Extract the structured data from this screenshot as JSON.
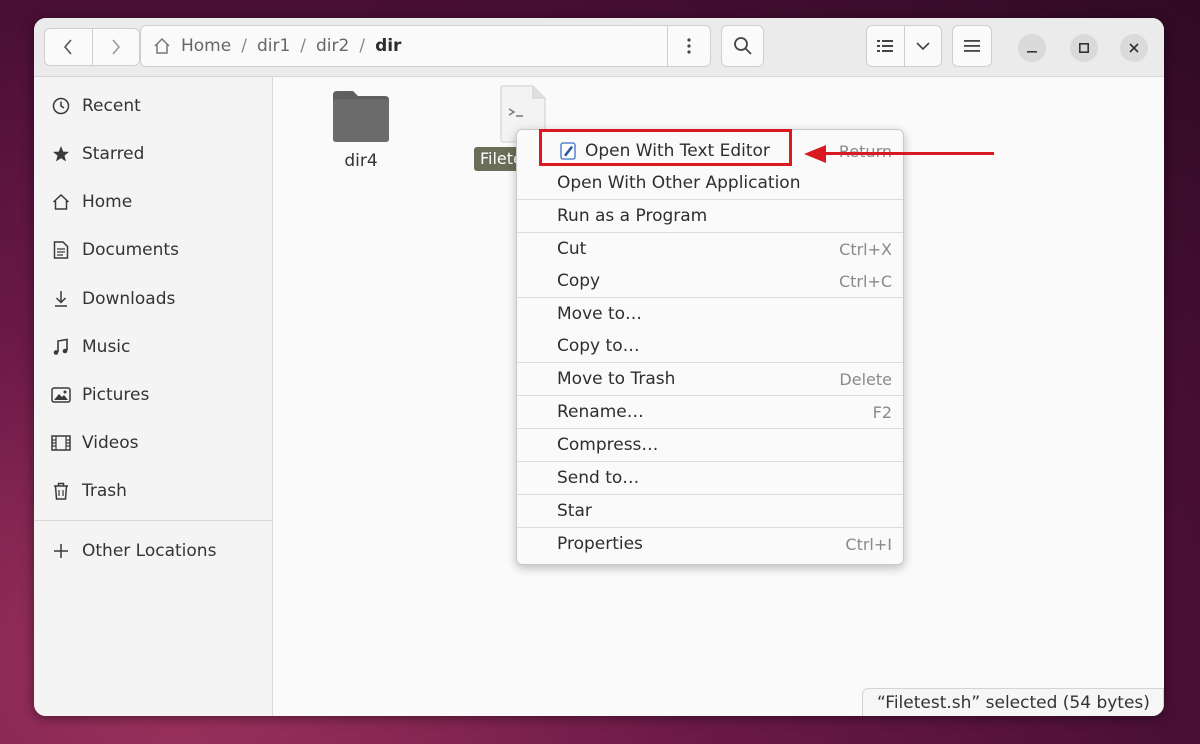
{
  "headerbar": {
    "path": [
      "Home",
      "dir1",
      "dir2",
      "dir"
    ],
    "path_separator": "/"
  },
  "sidebar": {
    "items": [
      {
        "label": "Recent",
        "icon": "clock-icon"
      },
      {
        "label": "Starred",
        "icon": "star-icon"
      },
      {
        "label": "Home",
        "icon": "home-icon"
      },
      {
        "label": "Documents",
        "icon": "document-icon"
      },
      {
        "label": "Downloads",
        "icon": "download-icon"
      },
      {
        "label": "Music",
        "icon": "music-icon"
      },
      {
        "label": "Pictures",
        "icon": "picture-icon"
      },
      {
        "label": "Videos",
        "icon": "video-icon"
      },
      {
        "label": "Trash",
        "icon": "trash-icon"
      }
    ],
    "other_locations": "Other Locations"
  },
  "files": [
    {
      "name": "dir4",
      "type": "folder"
    },
    {
      "name": "Filetest.sh",
      "type": "script",
      "selected": true
    }
  ],
  "context_menu": {
    "items": [
      {
        "label": "Open With Text Editor",
        "accel": "Return",
        "icon": "text-editor-icon"
      },
      {
        "label": "Open With Other Application",
        "accel": ""
      },
      {
        "label": "Run as a Program",
        "accel": ""
      },
      {
        "label": "Cut",
        "accel": "Ctrl+X"
      },
      {
        "label": "Copy",
        "accel": "Ctrl+C"
      },
      {
        "label": "Move to…",
        "accel": ""
      },
      {
        "label": "Copy to…",
        "accel": ""
      },
      {
        "label": "Move to Trash",
        "accel": "Delete"
      },
      {
        "label": "Rename…",
        "accel": "F2"
      },
      {
        "label": "Compress…",
        "accel": ""
      },
      {
        "label": "Send to…",
        "accel": ""
      },
      {
        "label": "Star",
        "accel": ""
      },
      {
        "label": "Properties",
        "accel": "Ctrl+I"
      }
    ]
  },
  "status": {
    "text": "“Filetest.sh” selected  (54 bytes)"
  },
  "colors": {
    "highlight": "#d9191f",
    "selection": "#6a6e57",
    "folder": "#6b6b6b"
  }
}
